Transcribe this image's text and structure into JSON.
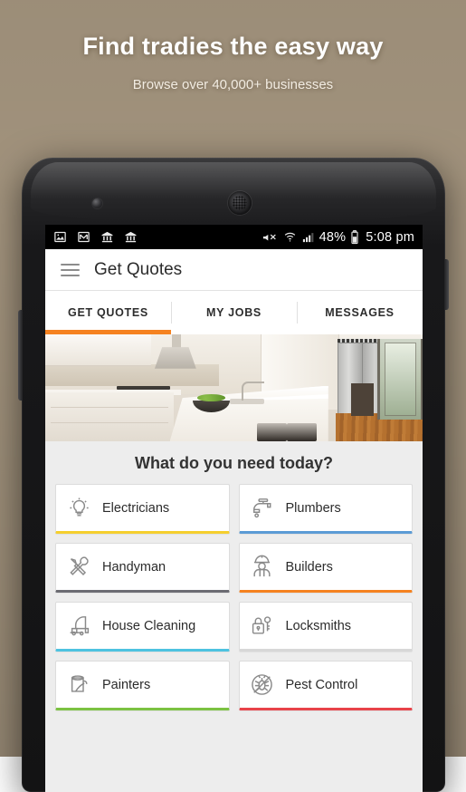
{
  "hero": {
    "headline": "Find tradies the easy way",
    "subheadline": "Browse over 40,000+ businesses"
  },
  "statusbar": {
    "icons_left": [
      "image-icon",
      "gmail-icon",
      "bank-icon",
      "bank-icon"
    ],
    "icons_right": [
      "mute-icon",
      "wifi-icon",
      "signal-icon"
    ],
    "battery_percent": "48%",
    "battery_icon": "battery-icon",
    "clock": "5:08 pm"
  },
  "actionbar": {
    "menu_icon": "hamburger-menu-icon",
    "title": "Get Quotes"
  },
  "tabs": [
    {
      "label": "GET QUOTES",
      "active": true
    },
    {
      "label": "MY JOBS",
      "active": false
    },
    {
      "label": "MESSAGES",
      "active": false
    }
  ],
  "hero_photo": {
    "alt": "modern white kitchen with island and stainless steel refrigerator"
  },
  "main": {
    "section_title": "What do you need today?",
    "categories": [
      {
        "label": "Electricians",
        "icon": "lightbulb-icon",
        "accent": "#f5cf2e"
      },
      {
        "label": "Plumbers",
        "icon": "tap-icon",
        "accent": "#5b9bd5"
      },
      {
        "label": "Handyman",
        "icon": "tools-icon",
        "accent": "#6b6b72"
      },
      {
        "label": "Builders",
        "icon": "builder-icon",
        "accent": "#f58220"
      },
      {
        "label": "House Cleaning",
        "icon": "vacuum-icon",
        "accent": "#4ec3e0"
      },
      {
        "label": "Locksmiths",
        "icon": "padlock-key-icon",
        "accent": "#d8d8d8"
      },
      {
        "label": "Painters",
        "icon": "paint-can-icon",
        "accent": "#7cc242"
      },
      {
        "label": "Pest Control",
        "icon": "bug-icon",
        "accent": "#e8434a"
      }
    ]
  },
  "theme": {
    "accent_orange": "#f58220",
    "screen_bg": "#ededed",
    "card_bg": "#ffffff",
    "status_bg": "#000000"
  }
}
